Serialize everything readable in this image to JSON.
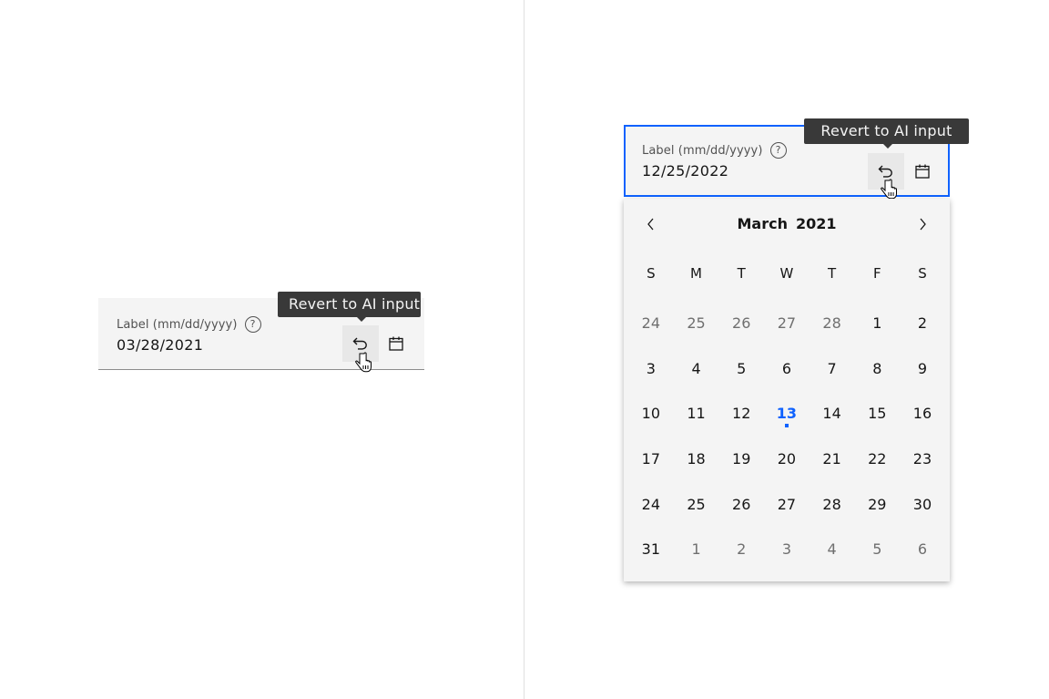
{
  "left_field": {
    "label": "Label (mm/dd/yyyy)",
    "value": "03/28/2021",
    "tooltip": "Revert to AI input"
  },
  "right_field": {
    "label": "Label (mm/dd/yyyy)",
    "value": "12/25/2022",
    "tooltip": "Revert to AI input",
    "focus_color": "#0f62fe"
  },
  "calendar": {
    "month": "March",
    "year": "2021",
    "weekdays": [
      "S",
      "M",
      "T",
      "W",
      "T",
      "F",
      "S"
    ],
    "days": [
      {
        "d": "24",
        "outside": true
      },
      {
        "d": "25",
        "outside": true
      },
      {
        "d": "26",
        "outside": true
      },
      {
        "d": "27",
        "outside": true
      },
      {
        "d": "28",
        "outside": true
      },
      {
        "d": "1"
      },
      {
        "d": "2"
      },
      {
        "d": "3"
      },
      {
        "d": "4"
      },
      {
        "d": "5"
      },
      {
        "d": "6"
      },
      {
        "d": "7"
      },
      {
        "d": "8"
      },
      {
        "d": "9"
      },
      {
        "d": "10"
      },
      {
        "d": "11"
      },
      {
        "d": "12"
      },
      {
        "d": "13",
        "today": true
      },
      {
        "d": "14"
      },
      {
        "d": "15"
      },
      {
        "d": "16"
      },
      {
        "d": "17"
      },
      {
        "d": "18"
      },
      {
        "d": "19"
      },
      {
        "d": "20"
      },
      {
        "d": "21"
      },
      {
        "d": "22"
      },
      {
        "d": "23"
      },
      {
        "d": "24"
      },
      {
        "d": "25"
      },
      {
        "d": "26"
      },
      {
        "d": "27"
      },
      {
        "d": "28"
      },
      {
        "d": "29"
      },
      {
        "d": "30"
      },
      {
        "d": "31"
      },
      {
        "d": "1",
        "outside": true
      },
      {
        "d": "2",
        "outside": true
      },
      {
        "d": "3",
        "outside": true
      },
      {
        "d": "4",
        "outside": true
      },
      {
        "d": "5",
        "outside": true
      },
      {
        "d": "6",
        "outside": true
      }
    ],
    "today_color": "#0f62fe"
  },
  "icons": {
    "help": "?",
    "revert": "undo-arrow",
    "calendar": "calendar",
    "prev": "chevron-left",
    "next": "chevron-right",
    "cursor": "hand-pointer"
  }
}
